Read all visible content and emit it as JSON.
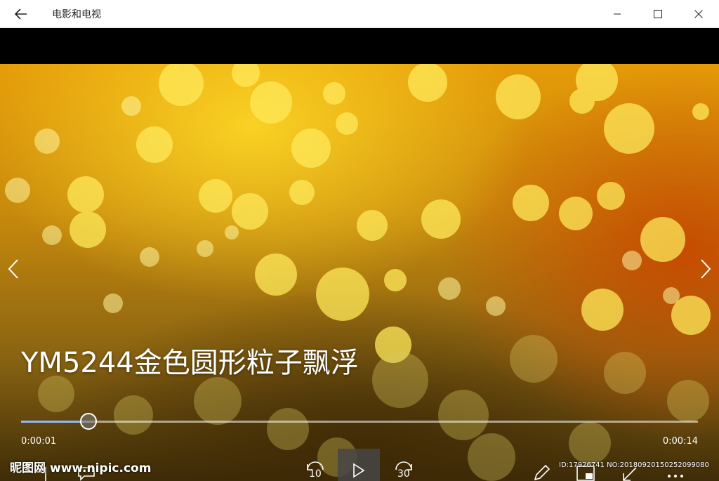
{
  "window": {
    "app_title": "电影和电视",
    "back_icon": "arrow-left-icon",
    "minimize_icon": "minimize-icon",
    "maximize_icon": "maximize-icon",
    "close_icon": "close-icon"
  },
  "player": {
    "video_title": "YM5244金色圆形粒子飘浮",
    "current_time": "0:00:01",
    "total_time": "0:00:14",
    "progress_fraction": 0.1,
    "accent_color": "#8fb8ff",
    "prev_icon": "chevron-left-icon",
    "next_icon": "chevron-right-icon"
  },
  "controls": {
    "skip_back_label": "10",
    "skip_forward_label": "30",
    "skip_back_icon": "rewind-10-icon",
    "play_icon": "play-icon",
    "skip_forward_icon": "forward-30-icon",
    "volume_icon": "volume-icon",
    "subtitles_icon": "subtitles-icon",
    "edit_icon": "pen-icon",
    "miniview_icon": "mini-view-icon",
    "fullscreen_icon": "fullscreen-icon",
    "more_icon": "more-icon"
  },
  "watermark": {
    "brand": "昵图网",
    "site": "www.nipic.com",
    "id_text": "ID:17926741 NO:20180920150252099080"
  }
}
